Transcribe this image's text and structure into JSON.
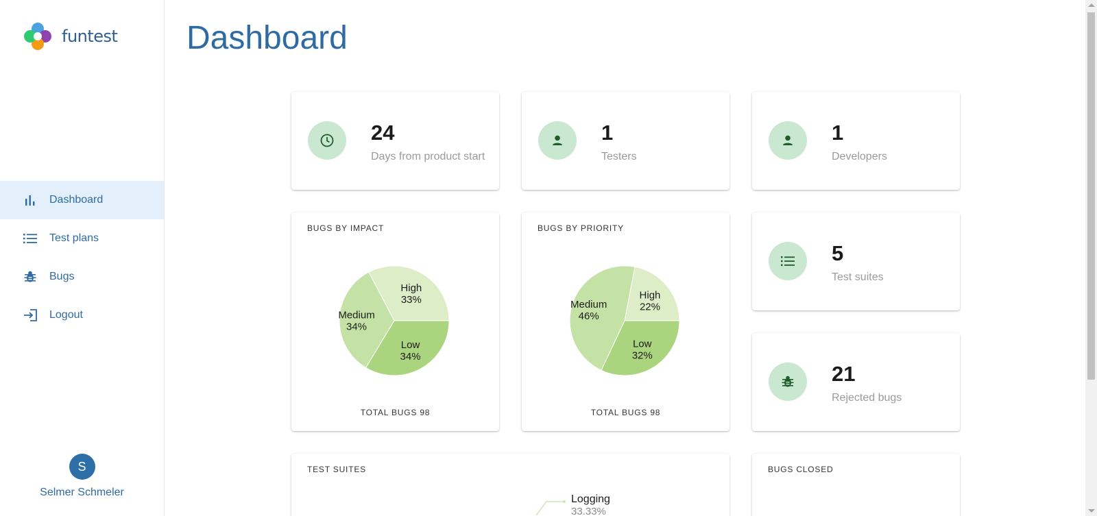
{
  "app": {
    "logo_text": "funtest"
  },
  "sidebar": {
    "items": [
      {
        "label": "Dashboard",
        "icon": "bar-chart-icon",
        "active": true
      },
      {
        "label": "Test plans",
        "icon": "list-icon"
      },
      {
        "label": "Bugs",
        "icon": "bug-icon"
      },
      {
        "label": "Logout",
        "icon": "logout-icon"
      }
    ],
    "user": {
      "initial": "S",
      "name": "Selmer Schmeler"
    }
  },
  "page": {
    "title": "Dashboard"
  },
  "stats": {
    "days": {
      "value": "24",
      "label": "Days from product start",
      "icon": "clock-icon"
    },
    "testers": {
      "value": "1",
      "label": "Testers",
      "icon": "person-icon"
    },
    "developers": {
      "value": "1",
      "label": "Developers",
      "icon": "person-icon"
    },
    "suites": {
      "value": "5",
      "label": "Test suites",
      "icon": "list-icon"
    },
    "rejected": {
      "value": "21",
      "label": "Rejected bugs",
      "icon": "bug-icon"
    }
  },
  "impact": {
    "title": "BUGS BY IMPACT",
    "footer": "TOTAL BUGS 98",
    "chart_data": {
      "type": "pie",
      "slices": [
        {
          "label": "High",
          "value": 33,
          "text": "33%"
        },
        {
          "label": "Low",
          "value": 34,
          "text": "34%"
        },
        {
          "label": "Medium",
          "value": 34,
          "text": "34%"
        }
      ]
    }
  },
  "priority": {
    "title": "BUGS BY PRIORITY",
    "footer": "TOTAL BUGS 98",
    "chart_data": {
      "type": "pie",
      "slices": [
        {
          "label": "High",
          "value": 22,
          "text": "22%"
        },
        {
          "label": "Low",
          "value": 32,
          "text": "32%"
        },
        {
          "label": "Medium",
          "value": 46,
          "text": "46%"
        }
      ]
    }
  },
  "test_suites": {
    "title": "TEST SUITES",
    "callout": {
      "label": "Logging",
      "value": "33.33%"
    }
  },
  "bugs_closed": {
    "title": "BUGS CLOSED"
  },
  "colors": {
    "primary": "#2e6ba3",
    "active_bg": "#e3f0fb",
    "icon_bg": "#c9e8cf",
    "icon_fg": "#1f5e2a",
    "pie": [
      "#ddedc8",
      "#abd47f",
      "#c5e2a6"
    ]
  }
}
